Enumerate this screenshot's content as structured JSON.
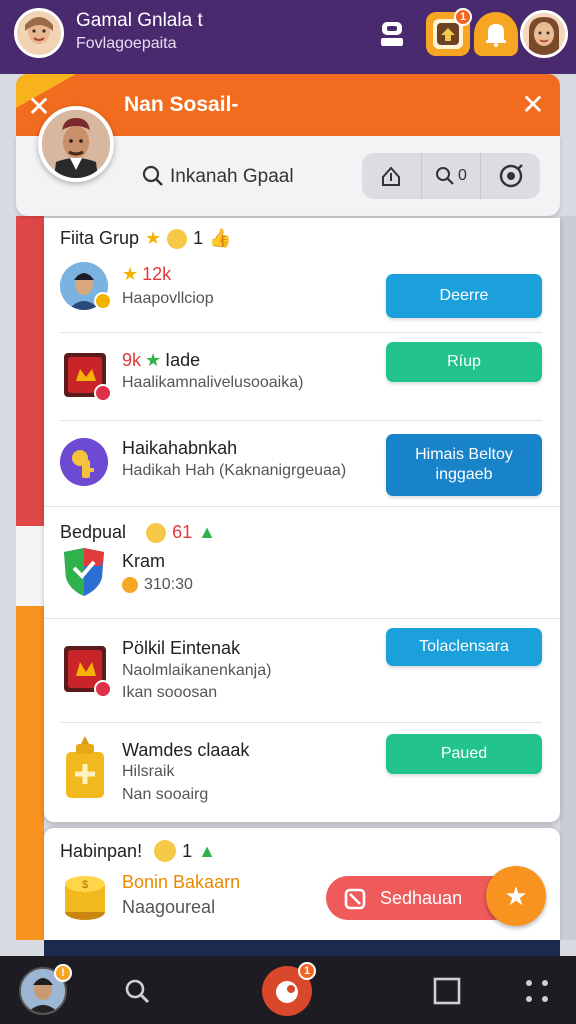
{
  "header": {
    "title": "Gamal Gnlala t",
    "subtitle": "Fovlagoepaita",
    "badges": {
      "game": "1",
      "profile": ""
    }
  },
  "card": {
    "title": "Nan Sosail-",
    "search_label": "Inkanah Gpaal",
    "search_count": "0"
  },
  "section1": {
    "title": "Fiita Grup",
    "count": "1",
    "rows": [
      {
        "title": "12k",
        "sub": "Haapovllciop",
        "action": "Deerre",
        "action_color": "blue"
      },
      {
        "title_prefix": "9k",
        "title": "Iade",
        "sub": "Haalikamnalivelusooaika)",
        "action": "Ríup",
        "action_color": "green"
      },
      {
        "title": "Haikahabnkah",
        "sub": "Hadikah Hah (Kaknanigrgeuaa)",
        "action": "Himais Beltoy inggaeb",
        "action_color": "blue"
      }
    ]
  },
  "section2": {
    "title": "Bedpual",
    "count": "61",
    "rows": [
      {
        "title": "Kram",
        "sub": "310:30"
      },
      {
        "title": "Pölkil Eintenak",
        "sub": "Naolmlaikanenkanja)",
        "sub2": "Ikan sooosan",
        "action": "Tolaclensara",
        "action_color": "blue"
      },
      {
        "title": "Wamdes claaak",
        "sub": "Hilsraik",
        "sub2": "Nan sooairg",
        "action": "Paued",
        "action_color": "green"
      }
    ]
  },
  "section3": {
    "title": "Habinpan!",
    "count": "1",
    "row": {
      "title": "Bonin Bakaarn",
      "sub": "Naagoureal"
    },
    "pill_label": "Sedhauan"
  },
  "nav": {
    "badge_left": "!",
    "badge_center": "1"
  },
  "colors": {
    "accent": "#f26c1f",
    "topbar": "#4a2a6e",
    "blue": "#1ba0dc",
    "green": "#22c48c",
    "red": "#ef5a5a"
  }
}
